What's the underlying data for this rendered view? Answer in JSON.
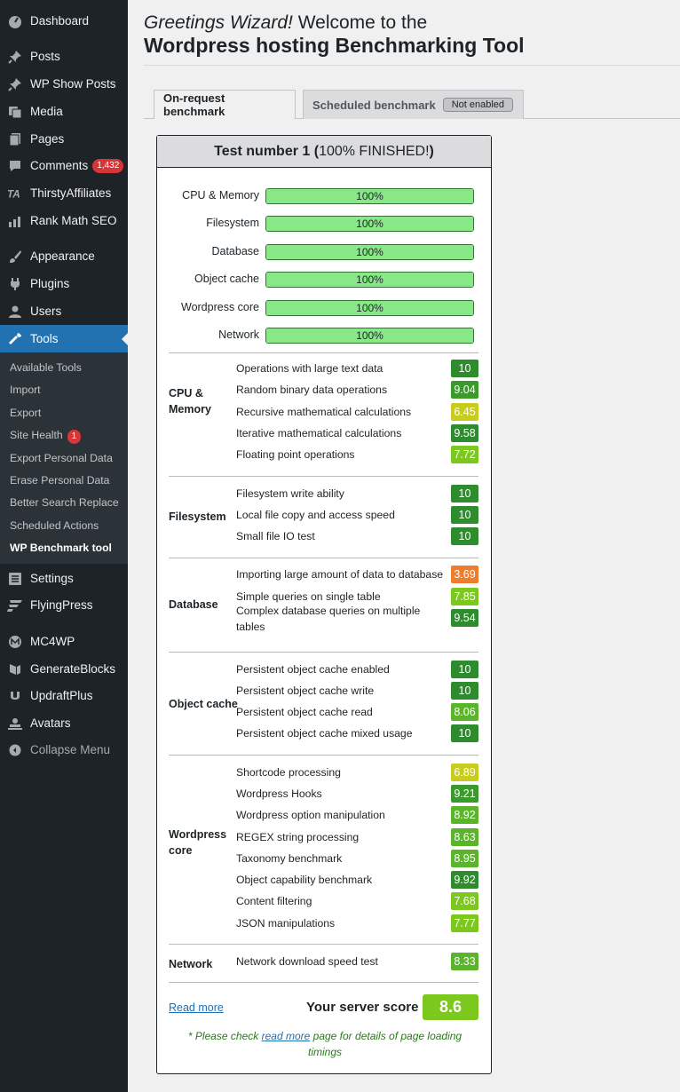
{
  "sidebar": {
    "items": [
      {
        "label": "Dashboard",
        "icon": "dashboard-icon"
      },
      {
        "label": "Posts",
        "icon": "pin-icon"
      },
      {
        "label": "WP Show Posts",
        "icon": "pin-icon"
      },
      {
        "label": "Media",
        "icon": "media-icon"
      },
      {
        "label": "Pages",
        "icon": "pages-icon"
      },
      {
        "label": "Comments",
        "icon": "comments-icon",
        "badge": "1,432"
      },
      {
        "label": "ThirstyAffiliates",
        "icon": "ta-icon"
      },
      {
        "label": "Rank Math SEO",
        "icon": "chart-icon"
      },
      {
        "label": "Appearance",
        "icon": "brush-icon"
      },
      {
        "label": "Plugins",
        "icon": "plug-icon"
      },
      {
        "label": "Users",
        "icon": "user-icon"
      },
      {
        "label": "Tools",
        "icon": "wrench-icon"
      },
      {
        "label": "Settings",
        "icon": "settings-icon"
      },
      {
        "label": "FlyingPress",
        "icon": "flyingpress-icon"
      },
      {
        "label": "MC4WP",
        "icon": "mc4wp-icon"
      },
      {
        "label": "GenerateBlocks",
        "icon": "blocks-icon"
      },
      {
        "label": "UpdraftPlus",
        "icon": "updraft-icon"
      },
      {
        "label": "Avatars",
        "icon": "avatars-icon"
      }
    ],
    "tools_sub": [
      {
        "label": "Available Tools"
      },
      {
        "label": "Import"
      },
      {
        "label": "Export"
      },
      {
        "label": "Site Health",
        "badge": "1"
      },
      {
        "label": "Export Personal Data"
      },
      {
        "label": "Erase Personal Data"
      },
      {
        "label": "Better Search Replace"
      },
      {
        "label": "Scheduled Actions"
      },
      {
        "label": "WP Benchmark tool"
      }
    ],
    "collapse_label": "Collapse Menu"
  },
  "header": {
    "greeting": "Greetings Wizard!",
    "welcome": " Welcome to the",
    "title": "Wordpress hosting Benchmarking Tool"
  },
  "tabs": {
    "on_request": "On-request benchmark",
    "scheduled": "Scheduled benchmark",
    "scheduled_badge": "Not enabled"
  },
  "panel": {
    "title_prefix": "Test number 1 (",
    "title_status": "100% FINISHED!",
    "title_suffix": ")",
    "progress": [
      {
        "label": "CPU & Memory",
        "value": 100,
        "text": "100%"
      },
      {
        "label": "Filesystem",
        "value": 100,
        "text": "100%"
      },
      {
        "label": "Database",
        "value": 100,
        "text": "100%"
      },
      {
        "label": "Object cache",
        "value": 100,
        "text": "100%"
      },
      {
        "label": "Wordpress core",
        "value": 100,
        "text": "100%"
      },
      {
        "label": "Network",
        "value": 100,
        "text": "100%"
      }
    ],
    "groups": [
      {
        "name": "CPU & Memory",
        "tests": [
          {
            "label": "Operations with large text data",
            "score": "10",
            "color": "#2e8b2e"
          },
          {
            "label": "Random binary data operations",
            "score": "9.04",
            "color": "#3a9a2a"
          },
          {
            "label": "Recursive mathematical calculations",
            "score": "6.45",
            "color": "#c8cc1e"
          },
          {
            "label": "Iterative mathematical calculations",
            "score": "9.58",
            "color": "#2e8b2e"
          },
          {
            "label": "Floating point operations",
            "score": "7.72",
            "color": "#7cc81f"
          }
        ]
      },
      {
        "name": "Filesystem",
        "tests": [
          {
            "label": "Filesystem write ability",
            "score": "10",
            "color": "#2e8b2e"
          },
          {
            "label": "Local file copy and access speed",
            "score": "10",
            "color": "#2e8b2e"
          },
          {
            "label": "Small file IO test",
            "score": "10",
            "color": "#2e8b2e"
          }
        ]
      },
      {
        "name": "Database",
        "tests": [
          {
            "label": "Importing large amount of data to database",
            "score": "3.69",
            "color": "#ef7d2e"
          },
          {
            "label": "Simple queries on single table",
            "score": "7.85",
            "color": "#7cc81f"
          },
          {
            "label": "Complex database queries on multiple tables",
            "score": "9.54",
            "color": "#2e8b2e"
          }
        ]
      },
      {
        "name": "Object cache",
        "tests": [
          {
            "label": "Persistent object cache enabled",
            "score": "10",
            "color": "#2e8b2e"
          },
          {
            "label": "Persistent object cache write",
            "score": "10",
            "color": "#2e8b2e"
          },
          {
            "label": "Persistent object cache read",
            "score": "8.06",
            "color": "#5ab52a"
          },
          {
            "label": "Persistent object cache mixed usage",
            "score": "10",
            "color": "#2e8b2e"
          }
        ]
      },
      {
        "name": "Wordpress core",
        "tests": [
          {
            "label": "Shortcode processing",
            "score": "6.89",
            "color": "#c8cc1e"
          },
          {
            "label": "Wordpress Hooks",
            "score": "9.21",
            "color": "#3a9a2a"
          },
          {
            "label": "Wordpress option manipulation",
            "score": "8.92",
            "color": "#5ab52a"
          },
          {
            "label": "REGEX string processing",
            "score": "8.63",
            "color": "#5ab52a"
          },
          {
            "label": "Taxonomy benchmark",
            "score": "8.95",
            "color": "#5ab52a"
          },
          {
            "label": "Object capability benchmark",
            "score": "9.92",
            "color": "#2e8b2e"
          },
          {
            "label": "Content filtering",
            "score": "7.68",
            "color": "#7cc81f"
          },
          {
            "label": "JSON manipulations",
            "score": "7.77",
            "color": "#7cc81f"
          }
        ]
      },
      {
        "name": "Network",
        "tests": [
          {
            "label": "Network download speed test",
            "score": "8.33",
            "color": "#5ab52a"
          }
        ]
      }
    ],
    "read_more": "Read more",
    "server_score_label": "Your server score",
    "server_score": "8.6",
    "note_prefix": "* Please check ",
    "note_link": "read more",
    "note_suffix": " page for details of page loading timings"
  }
}
